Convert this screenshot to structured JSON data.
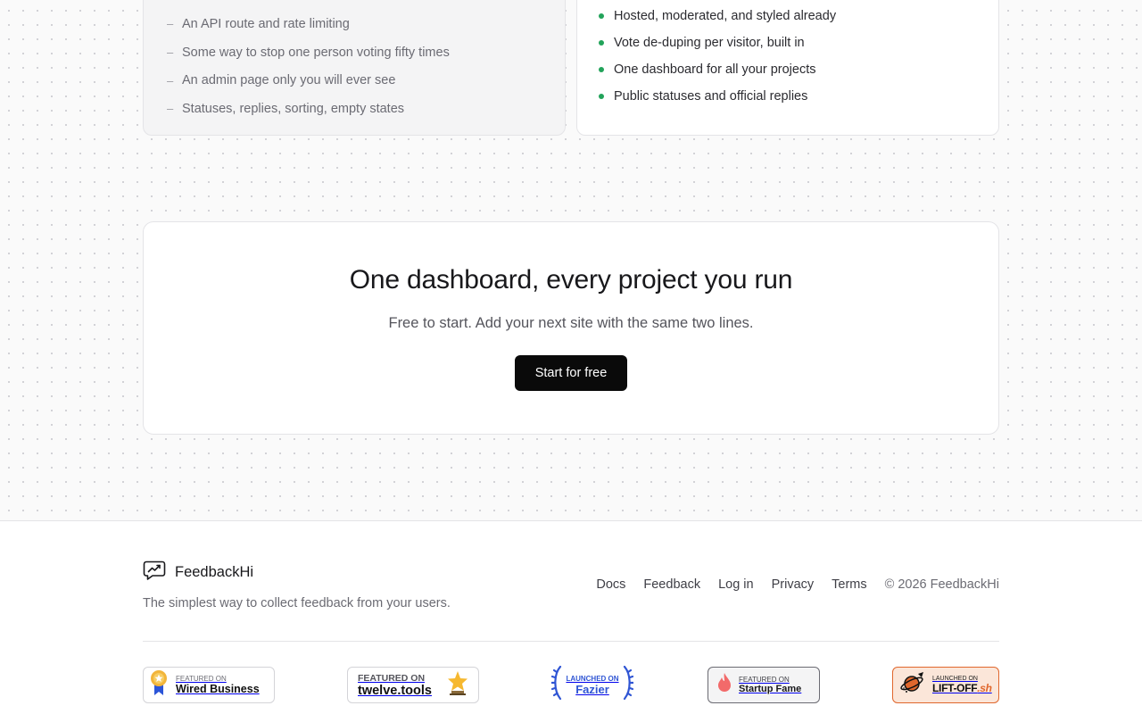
{
  "comparison": {
    "diy_items": [
      "An API route and rate limiting",
      "Some way to stop one person voting fifty times",
      "An admin page only you will ever see",
      "Statuses, replies, sorting, empty states"
    ],
    "ours_items": [
      "Hosted, moderated, and styled already",
      "Vote de-duping per visitor, built in",
      "One dashboard for all your projects",
      "Public statuses and official replies"
    ],
    "dash_glyph": "–",
    "accent_dot_color": "#22a35a"
  },
  "cta": {
    "title": "One dashboard, every project you run",
    "subtitle": "Free to start. Add your next site with the same two lines.",
    "button_label": "Start for free"
  },
  "footer": {
    "brand_name": "FeedbackHi",
    "logo_icon": "chat-trend-icon",
    "tagline": "The simplest way to collect feedback from your users.",
    "links": [
      "Docs",
      "Feedback",
      "Log in",
      "Privacy",
      "Terms"
    ],
    "copyright": "© 2026 FeedbackHi",
    "badges": {
      "wired": {
        "small": "FEATURED ON",
        "large": "Wired Business",
        "icon": "award-ribbon-icon"
      },
      "twelve": {
        "small": "FEATURED ON",
        "large": "twelve.tools",
        "icon": "star-trophy-icon"
      },
      "fazier": {
        "small": "LAUNCHED ON",
        "large": "Fazier",
        "icon": "laurel-icon"
      },
      "startup_fame": {
        "small": "FEATURED ON",
        "large": "Startup Fame",
        "icon": "flame-icon"
      },
      "liftoff": {
        "small": "LAUNCHED ON",
        "large": "LIFT-OFF",
        "suffix": ".sh",
        "icon": "planet-rocket-icon"
      }
    }
  }
}
